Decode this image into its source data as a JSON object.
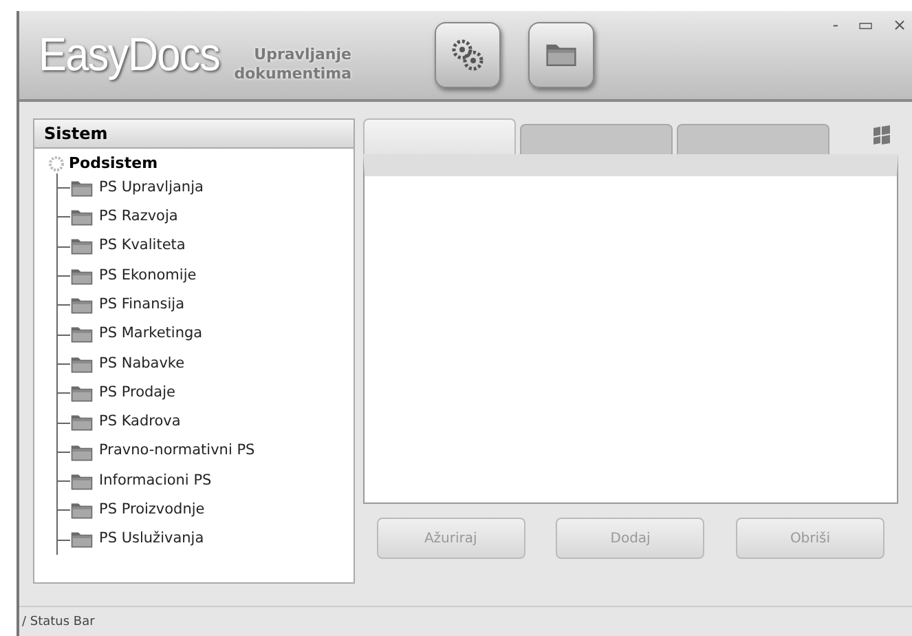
{
  "app": {
    "logo": "EasyDocs",
    "subtitle_lines": [
      "Upravljanje",
      "dokumentima"
    ]
  },
  "toolbar": [
    {
      "kind": "settings"
    },
    {
      "kind": "folder"
    }
  ],
  "window_controls": [
    "-",
    "▭",
    "×"
  ],
  "sidebar": {
    "title": "Sistem",
    "tree": {
      "label": "Podsistem",
      "expanded": true,
      "children": [
        {
          "label": "PS Upravljanja"
        },
        {
          "label": "PS Razvoja"
        },
        {
          "label": "PS Kvaliteta"
        },
        {
          "label": "PS Ekonomije"
        },
        {
          "label": "PS Finansija"
        },
        {
          "label": "PS Marketinga"
        },
        {
          "label": "PS Nabavke"
        },
        {
          "label": "PS Prodaje"
        },
        {
          "label": "PS Kadrova"
        },
        {
          "label": "Pravno-normativni PS"
        },
        {
          "label": "Informacioni PS"
        },
        {
          "label": "PS Proizvodnje"
        },
        {
          "label": "PS Usluživanja"
        }
      ]
    }
  },
  "tabs": [
    {
      "selected": true
    },
    {
      "selected": false
    },
    {
      "selected": false
    }
  ],
  "buttons": [
    {
      "label": "Ažuriraj",
      "disabled": true
    },
    {
      "label": "Dodaj",
      "disabled": true
    },
    {
      "label": "Obriši",
      "disabled": true
    }
  ],
  "status_bar": "/ Status Bar"
}
